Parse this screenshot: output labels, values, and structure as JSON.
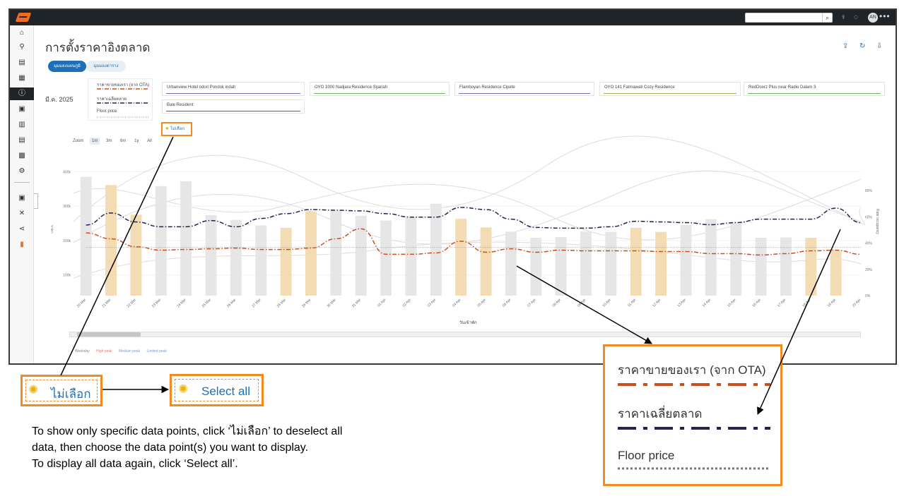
{
  "app": {
    "avatar_initials": "AN",
    "search_icon": "search-icon",
    "sidebar_icons": [
      "home-icon",
      "search-icon",
      "calendar-icon",
      "calendar-icon",
      "info-icon",
      "briefcase-icon",
      "document-icon",
      "document-icon",
      "chat-icon",
      "settings-icon",
      "save-icon",
      "tools-icon",
      "share-icon",
      "bag-icon"
    ]
  },
  "page": {
    "title": "การตั้งราคาอิงตลาด",
    "tabs": [
      "มุมมองแผนภูมิ",
      "มุมมองตาราง"
    ],
    "month": "มี.ค. 2025",
    "legend": {
      "our_price": "ราคาขายของเรา (จาก OTA)",
      "market_avg": "ราคาเฉลี่ยตลาด",
      "floor": "Floor price"
    },
    "hotels": [
      {
        "name": "Urbanview Hotel odori Pondok indah",
        "color": "#7b6bb8"
      },
      {
        "name": "OYO 3300 Nadjara Residence Syariah",
        "color": "#6dbb5e"
      },
      {
        "name": "Flamboyan Residence Cipete",
        "color": "#7b6bb8"
      },
      {
        "name": "OYO 141 Fatmawati Cozy Residence",
        "color": "#9bb561"
      },
      {
        "name": "RedDoorz Plus near Radio Dalam 3",
        "color": "#6dbb5e"
      },
      {
        "name": "Bale Resident",
        "color": "#8a5a3c"
      }
    ],
    "deselect_label": "ไม่เลือก",
    "zoom_label": "Zoom",
    "zoom_options": [
      "1m",
      "3m",
      "6m",
      "1y",
      "All"
    ],
    "zoom_selected": "1m",
    "x_axis_title": "วันเข้าพัก",
    "y_left_title": "ราคา",
    "y_right_title": "Rate occupancy",
    "scroll_label": "III",
    "peak_legend": [
      "Weekday",
      "High peak",
      "Medium peak",
      "Limited peak"
    ]
  },
  "chart_data": {
    "type": "bar",
    "categories": [
      "20 Mar",
      "21 Mar",
      "22 Mar",
      "23 Mar",
      "24 Mar",
      "25 Mar",
      "26 Mar",
      "27 Mar",
      "28 Mar",
      "29 Mar",
      "30 Mar",
      "31 Mar",
      "01 Apr",
      "02 Apr",
      "03 Apr",
      "04 Apr",
      "05 Apr",
      "06 Apr",
      "07 Apr",
      "08 Apr",
      "09 Apr",
      "10 Apr",
      "11 Apr",
      "12 Apr",
      "13 Apr",
      "14 Apr",
      "15 Apr",
      "16 Apr",
      "17 Apr",
      "18 Apr",
      "19 Apr",
      "20 Apr"
    ],
    "y_ticks": [
      "100k",
      "200k",
      "300k",
      "400k"
    ],
    "y_right_ticks": [
      "0%",
      "20%",
      "40%",
      "60%",
      "80%"
    ],
    "ylim": [
      40000,
      460000
    ],
    "bars": [
      {
        "value": 385000,
        "kind": "weekday"
      },
      {
        "value": 361000,
        "kind": "high"
      },
      {
        "value": 275000,
        "kind": "high"
      },
      {
        "value": 358000,
        "kind": "weekday"
      },
      {
        "value": 372000,
        "kind": "weekday"
      },
      {
        "value": 274000,
        "kind": "weekday"
      },
      {
        "value": 260000,
        "kind": "weekday"
      },
      {
        "value": 244000,
        "kind": "weekday"
      },
      {
        "value": 237000,
        "kind": "high"
      },
      {
        "value": 285000,
        "kind": "high"
      },
      {
        "value": 287000,
        "kind": "weekday"
      },
      {
        "value": 272000,
        "kind": "weekday"
      },
      {
        "value": 258000,
        "kind": "weekday"
      },
      {
        "value": 268000,
        "kind": "weekday"
      },
      {
        "value": 307000,
        "kind": "weekday"
      },
      {
        "value": 263000,
        "kind": "high"
      },
      {
        "value": 238000,
        "kind": "high"
      },
      {
        "value": 226000,
        "kind": "weekday"
      },
      {
        "value": 208000,
        "kind": "weekday"
      },
      {
        "value": 210000,
        "kind": "weekday"
      },
      {
        "value": 226000,
        "kind": "weekday"
      },
      {
        "value": 225000,
        "kind": "weekday"
      },
      {
        "value": 237000,
        "kind": "high"
      },
      {
        "value": 225000,
        "kind": "high"
      },
      {
        "value": 245000,
        "kind": "weekday"
      },
      {
        "value": 262000,
        "kind": "weekday"
      },
      {
        "value": 250000,
        "kind": "weekday"
      },
      {
        "value": 208000,
        "kind": "weekday"
      },
      {
        "value": 209000,
        "kind": "weekday"
      },
      {
        "value": 208000,
        "kind": "high"
      },
      {
        "value": 170000,
        "kind": "high"
      }
    ],
    "series": [
      {
        "name": "ราคาขายของเรา (จาก OTA)",
        "color": "#c8501e",
        "style": "dash-dot",
        "values": [
          222000,
          205000,
          182000,
          172000,
          174000,
          176000,
          178000,
          174000,
          174000,
          178000,
          205000,
          234000,
          160000,
          160000,
          164000,
          198000,
          166000,
          176000,
          166000,
          172000,
          170000,
          170000,
          170000,
          168000,
          168000,
          162000,
          162000,
          158000,
          162000,
          170000,
          172000,
          160000
        ]
      },
      {
        "name": "ราคาเฉลี่ยตลาด",
        "color": "#23234f",
        "style": "dash-dot",
        "values": [
          245000,
          280000,
          254000,
          240000,
          240000,
          258000,
          240000,
          264000,
          278000,
          290000,
          288000,
          286000,
          278000,
          268000,
          268000,
          296000,
          290000,
          262000,
          238000,
          236000,
          236000,
          240000,
          256000,
          254000,
          252000,
          246000,
          252000,
          262000,
          262000,
          262000,
          294000,
          252000
        ]
      },
      {
        "name": "Floor price",
        "color": "#999999",
        "style": "dotted",
        "values": [
          180000,
          180000,
          180000,
          180000,
          180000,
          180000,
          180000,
          180000,
          180000,
          180000,
          180000,
          180000,
          180000,
          180000,
          180000,
          180000,
          180000,
          180000,
          180000,
          180000,
          180000,
          180000,
          180000,
          180000,
          180000,
          180000,
          180000,
          180000,
          180000,
          180000,
          180000,
          180000
        ]
      }
    ]
  },
  "annotations": {
    "deselect_zoom_label": "ไม่เลือก",
    "select_all_label": "Select all",
    "instructions": [
      "To show only specific data points, click ‘ไม่เลือก’ to deselect all",
      "data, then choose the data point(s) you want to display.",
      "To display all data again, click ‘Select all’."
    ],
    "legend_zoom": {
      "our_price": "ราคาขายของเรา (จาก OTA)",
      "market_avg": "ราคาเฉลี่ยตลาด",
      "floor": "Floor price"
    }
  }
}
